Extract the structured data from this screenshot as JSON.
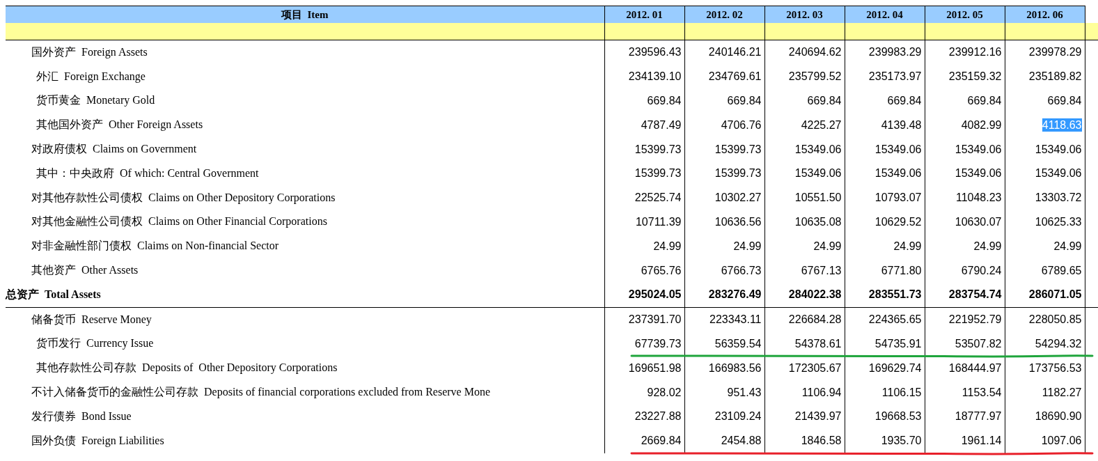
{
  "table": {
    "item_header": "项目  Item",
    "columns": [
      "2012. 01",
      "2012. 02",
      "2012. 03",
      "2012. 04",
      "2012. 05",
      "2012. 06"
    ],
    "sections": [
      {
        "rows": [
          {
            "label": "国外资产  Foreign Assets",
            "values": [
              "239596.43",
              "240146.21",
              "240694.62",
              "239983.29",
              "239912.16",
              "239978.29"
            ],
            "selected": [
              false,
              false,
              false,
              false,
              false,
              false
            ],
            "children": [
              {
                "label": "外汇  Foreign Exchange",
                "values": [
                  "234139.10",
                  "234769.61",
                  "235799.52",
                  "235173.97",
                  "235159.32",
                  "235189.82"
                ],
                "selected": [
                  false,
                  false,
                  false,
                  false,
                  false,
                  false
                ]
              },
              {
                "label": "货币黄金  Monetary Gold",
                "values": [
                  "669.84",
                  "669.84",
                  "669.84",
                  "669.84",
                  "669.84",
                  "669.84"
                ],
                "selected": [
                  false,
                  false,
                  false,
                  false,
                  false,
                  false
                ]
              },
              {
                "label": "其他国外资产  Other Foreign Assets",
                "values": [
                  "4787.49",
                  "4706.76",
                  "4225.27",
                  "4139.48",
                  "4082.99",
                  "4118.63"
                ],
                "selected": [
                  false,
                  false,
                  false,
                  false,
                  false,
                  true
                ]
              }
            ]
          },
          {
            "label": "对政府债权  Claims on Government",
            "values": [
              "15399.73",
              "15399.73",
              "15349.06",
              "15349.06",
              "15349.06",
              "15349.06"
            ],
            "selected": [
              false,
              false,
              false,
              false,
              false,
              false
            ],
            "children": [
              {
                "label": "其中：中央政府  Of which: Central Government",
                "values": [
                  "15399.73",
                  "15399.73",
                  "15349.06",
                  "15349.06",
                  "15349.06",
                  "15349.06"
                ],
                "selected": [
                  false,
                  false,
                  false,
                  false,
                  false,
                  false
                ]
              }
            ]
          },
          {
            "label": "对其他存款性公司债权  Claims on Other Depository Corporations",
            "values": [
              "22525.74",
              "10302.27",
              "10551.50",
              "10793.07",
              "11048.23",
              "13303.72"
            ],
            "selected": [
              false,
              false,
              false,
              false,
              false,
              false
            ]
          },
          {
            "label": "对其他金融性公司债权  Claims on Other Financial Corporations",
            "values": [
              "10711.39",
              "10636.56",
              "10635.08",
              "10629.52",
              "10630.07",
              "10625.33"
            ],
            "selected": [
              false,
              false,
              false,
              false,
              false,
              false
            ]
          },
          {
            "label": "对非金融性部门债权  Claims on Non-financial Sector",
            "values": [
              "24.99",
              "24.99",
              "24.99",
              "24.99",
              "24.99",
              "24.99"
            ],
            "selected": [
              false,
              false,
              false,
              false,
              false,
              false
            ]
          },
          {
            "label": "其他资产  Other Assets",
            "values": [
              "6765.76",
              "6766.73",
              "6767.13",
              "6771.80",
              "6790.24",
              "6789.65"
            ],
            "selected": [
              false,
              false,
              false,
              false,
              false,
              false
            ]
          }
        ],
        "total": {
          "label": "总资产  Total Assets",
          "values": [
            "295024.05",
            "283276.49",
            "284022.38",
            "283551.73",
            "283754.74",
            "286071.05"
          ],
          "selected": [
            false,
            false,
            false,
            false,
            false,
            false
          ]
        }
      },
      {
        "rows": [
          {
            "label": "储备货币  Reserve Money",
            "values": [
              "237391.70",
              "223343.11",
              "226684.28",
              "224365.65",
              "221952.79",
              "228050.85"
            ],
            "selected": [
              false,
              false,
              false,
              false,
              false,
              false
            ],
            "children": [
              {
                "label": "货币发行  Currency Issue",
                "values": [
                  "67739.73",
                  "56359.54",
                  "54378.61",
                  "54735.91",
                  "53507.82",
                  "54294.32"
                ],
                "selected": [
                  false,
                  false,
                  false,
                  false,
                  false,
                  false
                ],
                "underline": {
                  "color": "#1fa53c"
                }
              },
              {
                "label": "其他存款性公司存款  Deposits of  Other Depository Corporations",
                "values": [
                  "169651.98",
                  "166983.56",
                  "172305.67",
                  "169629.74",
                  "168444.97",
                  "173756.53"
                ],
                "selected": [
                  false,
                  false,
                  false,
                  false,
                  false,
                  false
                ]
              }
            ]
          },
          {
            "label": "不计入储备货币的金融性公司存款  Deposits of financial corporations excluded from Reserve Mone",
            "values": [
              "928.02",
              "951.43",
              "1106.94",
              "1106.15",
              "1153.54",
              "1182.27"
            ],
            "selected": [
              false,
              false,
              false,
              false,
              false,
              false
            ]
          },
          {
            "label": "发行债券  Bond Issue",
            "values": [
              "23227.88",
              "23109.24",
              "21439.97",
              "19668.53",
              "18777.97",
              "18690.90"
            ],
            "selected": [
              false,
              false,
              false,
              false,
              false,
              false
            ]
          },
          {
            "label": "国外负债  Foreign Liabilities",
            "values": [
              "2669.84",
              "2454.88",
              "1846.58",
              "1935.70",
              "1961.14",
              "1097.06"
            ],
            "selected": [
              false,
              false,
              false,
              false,
              false,
              false
            ],
            "underline": {
              "color": "#e8202a"
            }
          }
        ]
      }
    ]
  }
}
